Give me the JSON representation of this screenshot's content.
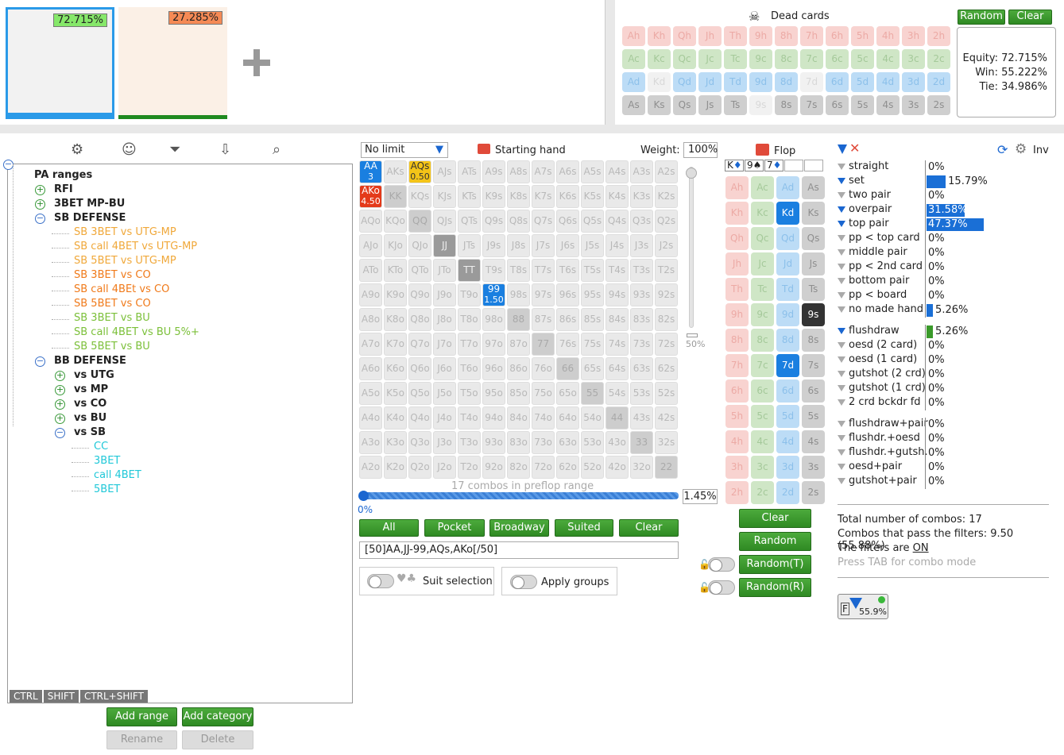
{
  "top": {
    "range1_pct": "72.715%",
    "range2_pct": "27.285%",
    "add_icon": "plus-icon",
    "dead_cards_label": "Dead cards",
    "random_label": "Random",
    "clear_label": "Clear",
    "equity": "Equity: 72.715%",
    "win": "Win: 55.222%",
    "tie": "Tie: 34.986%"
  },
  "dead_cards": {
    "hearts": [
      "Ah",
      "Kh",
      "Qh",
      "Jh",
      "Th",
      "9h",
      "8h",
      "7h",
      "6h",
      "5h",
      "4h",
      "3h",
      "2h"
    ],
    "clubs": [
      "Ac",
      "Kc",
      "Qc",
      "Jc",
      "Tc",
      "9c",
      "8c",
      "7c",
      "6c",
      "5c",
      "4c",
      "3c",
      "2c"
    ],
    "diamonds": [
      "Ad",
      "Kd",
      "Qd",
      "Jd",
      "Td",
      "9d",
      "8d",
      "7d",
      "6d",
      "5d",
      "4d",
      "3d",
      "2d"
    ],
    "spades": [
      "As",
      "Ks",
      "Qs",
      "Js",
      "Ts",
      "9s",
      "8s",
      "7s",
      "6s",
      "5s",
      "4s",
      "3s",
      "2s"
    ]
  },
  "tree": {
    "root": "PA ranges",
    "items": [
      {
        "label": "RFI",
        "color": "#222",
        "bold": true,
        "pm": "plus"
      },
      {
        "label": "3BET MP-BU",
        "color": "#222",
        "bold": true,
        "pm": "plus"
      },
      {
        "label": "SB DEFENSE",
        "color": "#222",
        "bold": true,
        "pm": "minus"
      },
      {
        "label": "SB 3BET vs UTG-MP",
        "color": "#f0a83a"
      },
      {
        "label": "SB call 4BET vs UTG-MP",
        "color": "#f0a83a"
      },
      {
        "label": "SB 5BET vs UTG-MP",
        "color": "#f0a83a"
      },
      {
        "label": "SB 3BET vs CO",
        "color": "#f07a1a"
      },
      {
        "label": "SB call 4BEt vs CO",
        "color": "#f07a1a"
      },
      {
        "label": "SB 5BET vs CO",
        "color": "#f07a1a"
      },
      {
        "label": "SB 3BET vs BU",
        "color": "#7cc03a"
      },
      {
        "label": "SB call 4BET vs BU 5%+",
        "color": "#7cc03a"
      },
      {
        "label": "SB 5BET vs BU",
        "color": "#7cc03a"
      },
      {
        "label": "BB DEFENSE",
        "color": "#222",
        "bold": true,
        "pm": "minus"
      },
      {
        "label": "vs UTG",
        "color": "#222",
        "bold": true,
        "pm": "plus"
      },
      {
        "label": "vs MP",
        "color": "#222",
        "bold": true,
        "pm": "plus"
      },
      {
        "label": "vs CO",
        "color": "#222",
        "bold": true,
        "pm": "plus"
      },
      {
        "label": "vs BU",
        "color": "#222",
        "bold": true,
        "pm": "plus"
      },
      {
        "label": "vs SB",
        "color": "#222",
        "bold": true,
        "pm": "minus"
      },
      {
        "label": "CC",
        "color": "#20c8d8"
      },
      {
        "label": "3BET",
        "color": "#20c8d8"
      },
      {
        "label": "call 4BET",
        "color": "#20c8d8"
      },
      {
        "label": "5BET",
        "color": "#20c8d8"
      }
    ],
    "mod_keys": [
      "CTRL",
      "SHIFT",
      "CTRL+SHIFT"
    ],
    "add_range": "Add range",
    "add_category": "Add category",
    "rename": "Rename",
    "delete": "Delete"
  },
  "preflop": {
    "limit": "No limit",
    "starting_hand": "Starting hand",
    "weight_label": "Weight:",
    "weight_value": "100%",
    "ranks": [
      "A",
      "K",
      "Q",
      "J",
      "T",
      "9",
      "8",
      "7",
      "6",
      "5",
      "4",
      "3",
      "2"
    ],
    "combos_label": "17 combos in preflop range",
    "slider_min": "0%",
    "pct_value": "1.45%",
    "slider_50": "50%",
    "buttons": [
      "All",
      "Pocket",
      "Broadway",
      "Suited",
      "Clear"
    ],
    "range_text": "[50]AA,JJ-99,AQs,AKo[/50]",
    "suit_selection": "Suit selection",
    "apply_groups": "Apply groups",
    "aa_w": "3",
    "aqs_w": "0.50",
    "ako_w": "4.50",
    "n99_w": "1.50"
  },
  "flop": {
    "label": "Flop",
    "board": [
      "K",
      "9",
      "7"
    ],
    "board_suits": [
      "♦",
      "♠",
      "♦"
    ],
    "clear": "Clear",
    "random": "Random",
    "random_t": "Random(T)",
    "random_r": "Random(R)"
  },
  "stats": {
    "inv": "Inv",
    "rows1": [
      {
        "label": "straight",
        "pct": "0%",
        "on": false,
        "bar": 0
      },
      {
        "label": "set",
        "pct": "15.79%",
        "on": true,
        "bar": 15.79
      },
      {
        "label": "two pair",
        "pct": "0%",
        "on": false,
        "bar": 0
      },
      {
        "label": "overpair",
        "pct": "31.58%",
        "on": true,
        "bar": 31.58
      },
      {
        "label": "top pair",
        "pct": "47.37%",
        "on": true,
        "bar": 47.37
      },
      {
        "label": "pp < top card",
        "pct": "0%",
        "on": false,
        "bar": 0
      },
      {
        "label": "middle pair",
        "pct": "0%",
        "on": false,
        "bar": 0
      },
      {
        "label": "pp < 2nd card",
        "pct": "0%",
        "on": false,
        "bar": 0
      },
      {
        "label": "bottom pair",
        "pct": "0%",
        "on": false,
        "bar": 0
      },
      {
        "label": "pp < board",
        "pct": "0%",
        "on": false,
        "bar": 0
      },
      {
        "label": "no made hand",
        "pct": "5.26%",
        "on": false,
        "bar": 5.26
      }
    ],
    "rows2": [
      {
        "label": "flushdraw",
        "pct": "5.26%",
        "on": true,
        "bar": 5.26
      },
      {
        "label": "oesd (2 card)",
        "pct": "0%",
        "on": false,
        "bar": 0
      },
      {
        "label": "oesd (1 card)",
        "pct": "0%",
        "on": false,
        "bar": 0
      },
      {
        "label": "gutshot (2 crd)",
        "pct": "0%",
        "on": false,
        "bar": 0
      },
      {
        "label": "gutshot (1 crd)",
        "pct": "0%",
        "on": false,
        "bar": 0
      },
      {
        "label": "2 crd bckdr fd",
        "pct": "0%",
        "on": false,
        "bar": 0
      }
    ],
    "rows3": [
      {
        "label": "flushdraw+pair",
        "pct": "0%",
        "on": false,
        "bar": 0
      },
      {
        "label": "flushdr.+oesd",
        "pct": "0%",
        "on": false,
        "bar": 0
      },
      {
        "label": "flushdr.+gutsh.",
        "pct": "0%",
        "on": false,
        "bar": 0
      },
      {
        "label": "oesd+pair",
        "pct": "0%",
        "on": false,
        "bar": 0
      },
      {
        "label": "gutshot+pair",
        "pct": "0%",
        "on": false,
        "bar": 0
      }
    ],
    "total": "Total number of combos: 17",
    "pass": "Combos that pass the filters: 9.50 (55.88%)",
    "filters_on_prefix": "The filters are ",
    "filters_on": "ON",
    "press_tab": "Press TAB for combo mode",
    "filter_pct": "55.9%"
  }
}
